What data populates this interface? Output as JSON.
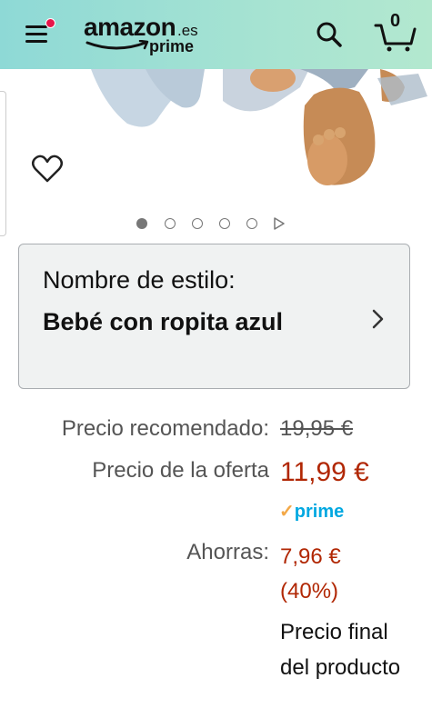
{
  "header": {
    "logo_word": "amazon",
    "logo_tld": ".es",
    "logo_prime": "prime",
    "cart_count": "0",
    "colors": {
      "bg_start": "#8ed9d6",
      "bg_end": "#b3e8cf",
      "notification_dot": "#e8154a"
    }
  },
  "icons": [
    "menu-icon",
    "search-icon",
    "cart-icon",
    "heart-icon",
    "chevron-right-icon",
    "play-icon"
  ],
  "carousel": {
    "image_count_dots": 5,
    "active_index": 0
  },
  "style": {
    "label": "Nombre de estilo:",
    "value": "Bebé con ropita azul"
  },
  "pricing": {
    "list_label": "Precio recomendado:",
    "list_value": "19,95 €",
    "deal_label": "Precio de la oferta",
    "deal_value": "11,99 €",
    "prime_label": "prime",
    "save_label": "Ahorras:",
    "save_value": "7,96 €",
    "save_percent": "(40%)",
    "final_note": "Precio final del producto",
    "colors": {
      "price": "#b12704",
      "prime": "#00a8e1",
      "prime_check": "#f3a847"
    }
  }
}
